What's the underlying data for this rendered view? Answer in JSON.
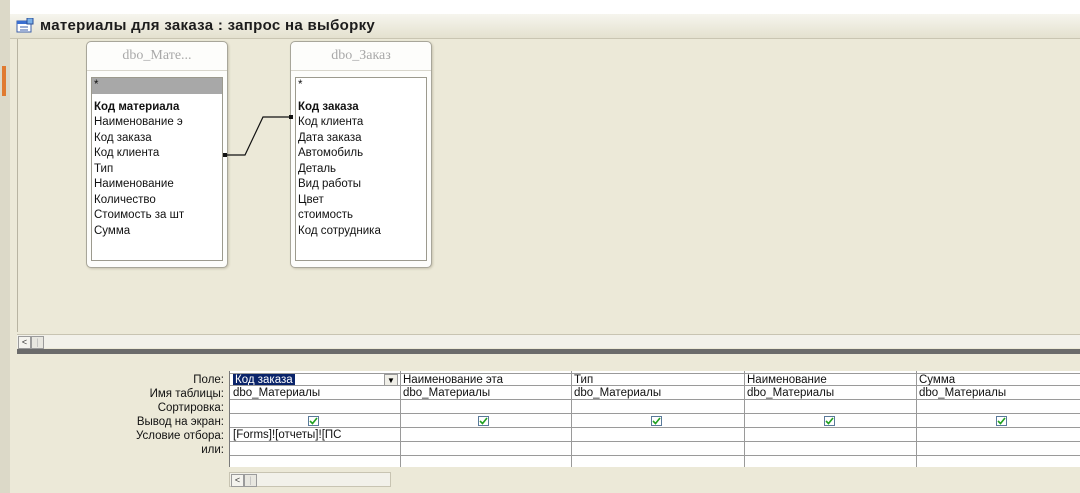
{
  "window": {
    "title": "материалы для заказа : запрос на выборку"
  },
  "tables": [
    {
      "title": "dbo_Мате...",
      "fields": [
        "*",
        "Код материала",
        "Наименование э",
        "Код заказа",
        "Код клиента",
        "Тип",
        "Наименование",
        "Количество",
        "Стоимость за шт",
        "Сумма"
      ]
    },
    {
      "title": "dbo_Заказ",
      "fields": [
        "*",
        "Код заказа",
        "Код клиента",
        "Дата заказа",
        "Автомобиль",
        "Деталь",
        "Вид работы",
        "Цвет",
        "стоимость",
        "Код сотрудника"
      ]
    }
  ],
  "grid": {
    "row_labels": [
      "Поле:",
      "Имя таблицы:",
      "Сортировка:",
      "Вывод на экран:",
      "Условие отбора:",
      "или:"
    ],
    "columns": [
      {
        "field": "Код заказа",
        "table": "dbo_Материалы",
        "show": true,
        "criteria": "[Forms]![отчеты]![ПС"
      },
      {
        "field": "Наименование эта",
        "table": "dbo_Материалы",
        "show": true,
        "criteria": ""
      },
      {
        "field": "Тип",
        "table": "dbo_Материалы",
        "show": true,
        "criteria": ""
      },
      {
        "field": "Наименование",
        "table": "dbo_Материалы",
        "show": true,
        "criteria": ""
      },
      {
        "field": "Сумма",
        "table": "dbo_Материалы",
        "show": true,
        "criteria": ""
      }
    ]
  },
  "icons": {
    "title": "query-icon",
    "scroll_left": "scroll-left-arrow-icon",
    "combo": "dropdown-arrow-icon",
    "check": "checkmark-icon"
  }
}
